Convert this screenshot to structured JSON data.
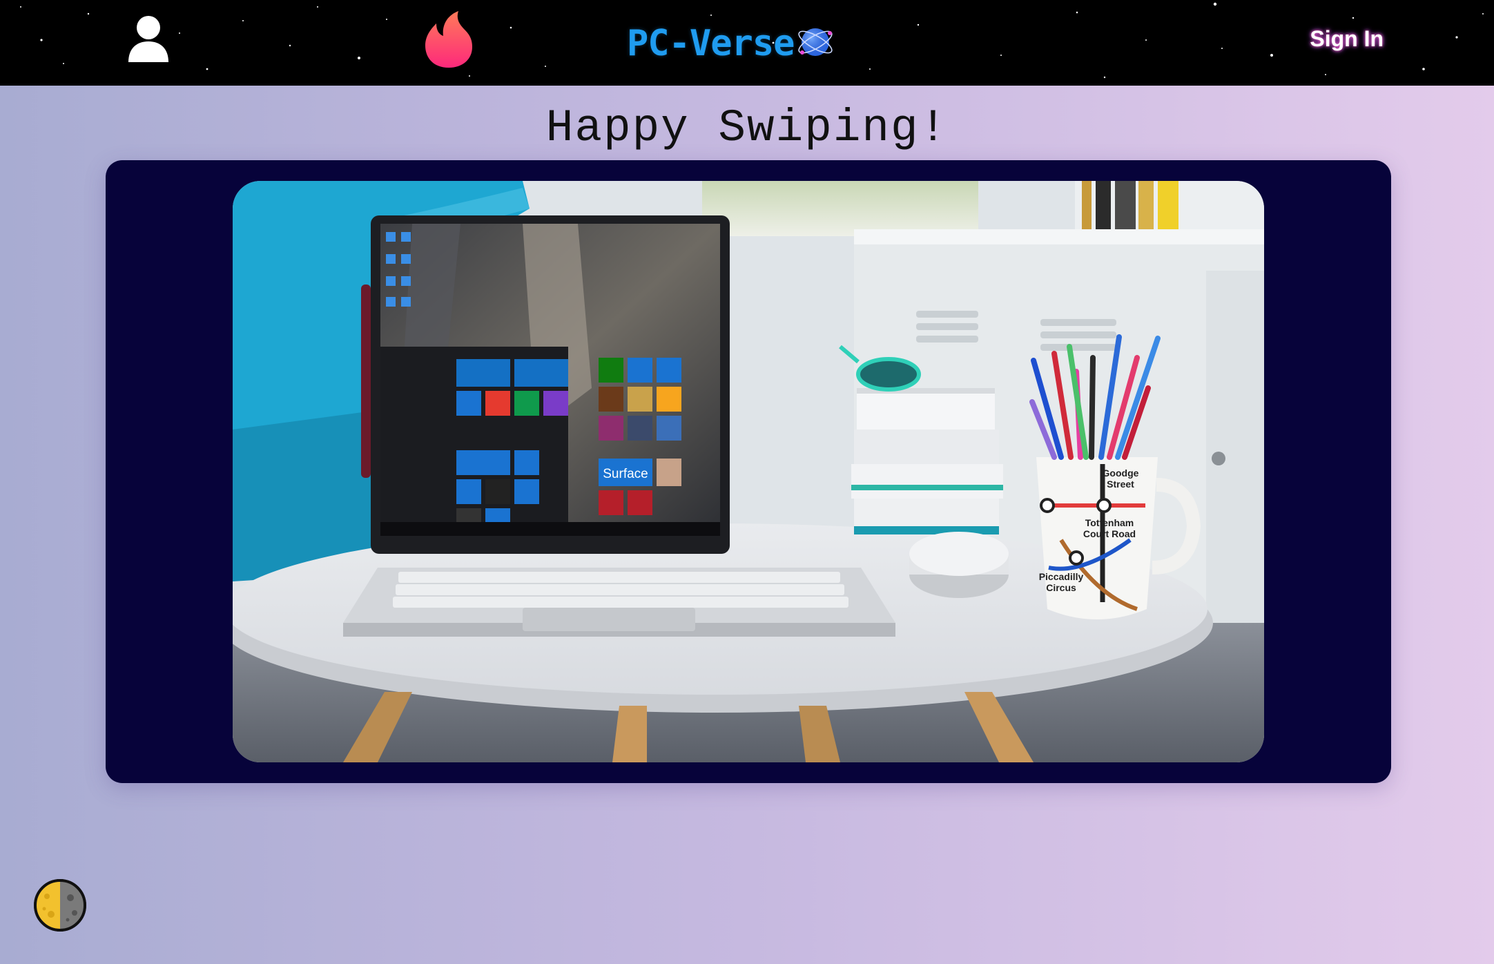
{
  "nav": {
    "brand": "PC-Verse",
    "signin_label": "Sign In"
  },
  "main": {
    "heading": "Happy Swiping!"
  },
  "card": {
    "screen_tile_label": "Surface",
    "mug_lines": [
      "Goodge",
      "Street",
      "Tottenham",
      "Court Road",
      "Piccadilly",
      "Circus"
    ]
  },
  "icons": {
    "user": "user-icon",
    "flame": "flame-icon",
    "atom": "atom-icon",
    "theme": "moon-icon"
  },
  "colors": {
    "navbar": "#000000",
    "brand": "#1f9cf0",
    "card": "#07033a",
    "flame_top": "#ff7a59",
    "flame_bottom": "#fd297b"
  }
}
